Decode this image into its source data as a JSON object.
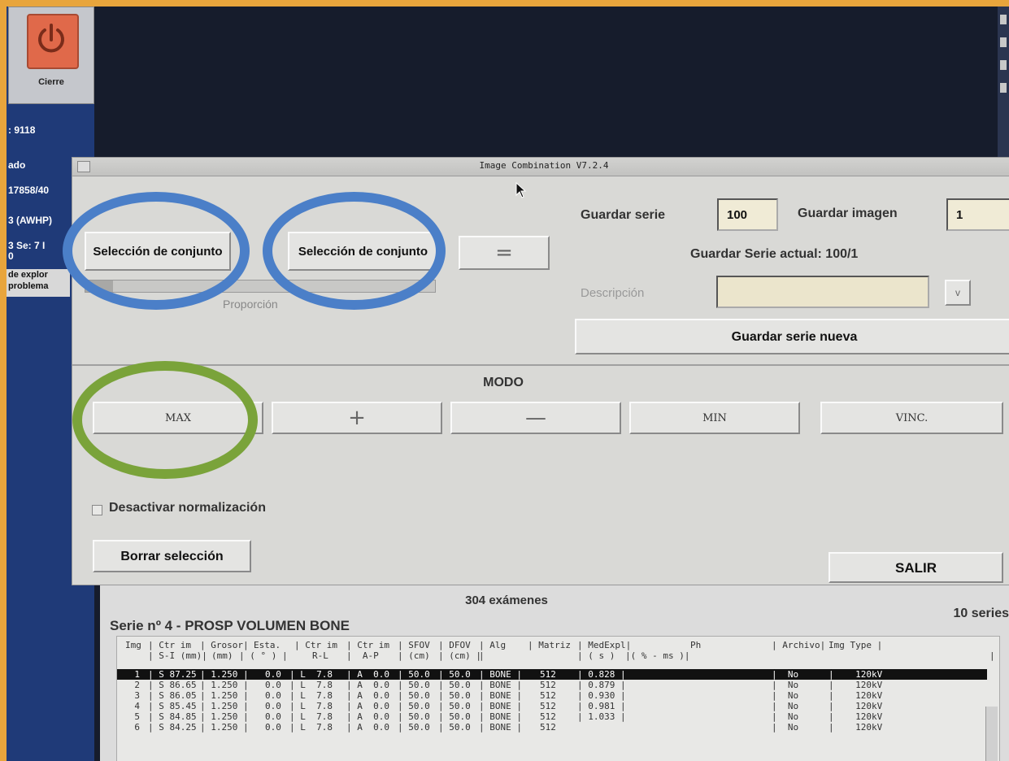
{
  "left_panel": {
    "power_label": "Cierre",
    "exam_number": ": 9118",
    "line_ado": "ado",
    "line_id": "17858/40",
    "line_awhp": "3 (AWHP)",
    "line_se": "3 Se: 7 I",
    "line_zero": "0",
    "tag_line1": "de explor",
    "tag_line2": "problema"
  },
  "dialog": {
    "title": "Image Combination V7.2.4",
    "sel1_label": "Selección de conjunto",
    "plus_op": "+",
    "sel2_label": "Selección de conjunto",
    "equals_label": "=",
    "progress": 0.08,
    "proportion_label": "Proporción",
    "guardar_serie_label": "Guardar serie",
    "guardar_serie_value": "100",
    "guardar_imagen_label": "Guardar imagen",
    "guardar_imagen_value": "1",
    "serie_actual_label": "Guardar Serie actual: 100/1",
    "descripcion_label": "Descripción",
    "descripcion_value": "",
    "desc_dropdown": "v",
    "guardar_nueva_label": "Guardar serie nueva",
    "modo_label": "MODO",
    "modes": [
      "MAX",
      "+",
      "—",
      "MIN",
      "VINC."
    ],
    "normalization_label": "Desactivar normalización",
    "normalization_checked": false,
    "borrar_label": "Borrar selección",
    "salir_label": "SALIR"
  },
  "list": {
    "exam_count": "304 exámenes",
    "series_title": "Serie nº 4 - PROSP   VOLUMEN BONE",
    "series_count": "10 series",
    "headers_line1": [
      "Img",
      "| Ctr im",
      "| Grosor|",
      "Esta.",
      "| Ctr im",
      "| Ctr im",
      "| SFOV",
      "| DFOV",
      "| Alg",
      "| Matriz",
      "| MedExpl|",
      "Ph",
      "| Archivo|",
      "Img Type |"
    ],
    "headers_line2": [
      "",
      "| S-I (mm)|",
      "(mm)",
      "| ( ° ) |",
      "R-L",
      "|  A-P",
      "| (cm)",
      "| (cm) |",
      "|",
      "",
      "| ( s )",
      "|( % - ms )|",
      "",
      "|"
    ],
    "rows": [
      {
        "img": "1",
        "si": "| S 87.25",
        "grosor": "| 1.250 |",
        "esta": "0.0",
        "rl": "| L  7.8",
        "ap": "| A  0.0",
        "sfov": "| 50.0",
        "dfov": "| 50.0",
        "alg": "| BONE |",
        "matriz": "512",
        "medexp": "| 0.828 |",
        "ph": "",
        "archivo": "|  No",
        "type": "|    120kV",
        "selected": true
      },
      {
        "img": "2",
        "si": "| S 86.65",
        "grosor": "| 1.250 |",
        "esta": "0.0",
        "rl": "| L  7.8",
        "ap": "| A  0.0",
        "sfov": "| 50.0",
        "dfov": "| 50.0",
        "alg": "| BONE |",
        "matriz": "512",
        "medexp": "| 0.879 |",
        "ph": "",
        "archivo": "|  No",
        "type": "|    120kV",
        "selected": false
      },
      {
        "img": "3",
        "si": "| S 86.05",
        "grosor": "| 1.250 |",
        "esta": "0.0",
        "rl": "| L  7.8",
        "ap": "| A  0.0",
        "sfov": "| 50.0",
        "dfov": "| 50.0",
        "alg": "| BONE |",
        "matriz": "512",
        "medexp": "| 0.930 |",
        "ph": "",
        "archivo": "|  No",
        "type": "|    120kV",
        "selected": false
      },
      {
        "img": "4",
        "si": "| S 85.45",
        "grosor": "| 1.250 |",
        "esta": "0.0",
        "rl": "| L  7.8",
        "ap": "| A  0.0",
        "sfov": "| 50.0",
        "dfov": "| 50.0",
        "alg": "| BONE |",
        "matriz": "512",
        "medexp": "| 0.981 |",
        "ph": "",
        "archivo": "|  No",
        "type": "|    120kV",
        "selected": false
      },
      {
        "img": "5",
        "si": "| S 84.85",
        "grosor": "| 1.250 |",
        "esta": "0.0",
        "rl": "| L  7.8",
        "ap": "| A  0.0",
        "sfov": "| 50.0",
        "dfov": "| 50.0",
        "alg": "| BONE |",
        "matriz": "512",
        "medexp": "| 1.033 |",
        "ph": "",
        "archivo": "|  No",
        "type": "|    120kV",
        "selected": false
      },
      {
        "img": "6",
        "si": "| S 84.25",
        "grosor": "| 1.250 |",
        "esta": "0.0",
        "rl": "| L  7.8",
        "ap": "| A  0.0",
        "sfov": "| 50.0",
        "dfov": "| 50.0",
        "alg": "| BONE |",
        "matriz": "512",
        "medexp": "",
        "ph": "",
        "archivo": "|  No",
        "type": "|    120kV",
        "selected": false
      }
    ]
  },
  "colors": {
    "frame": "#e8a53c",
    "blue_ring": "#4b7fc8",
    "green_ring": "#7aa33a"
  }
}
